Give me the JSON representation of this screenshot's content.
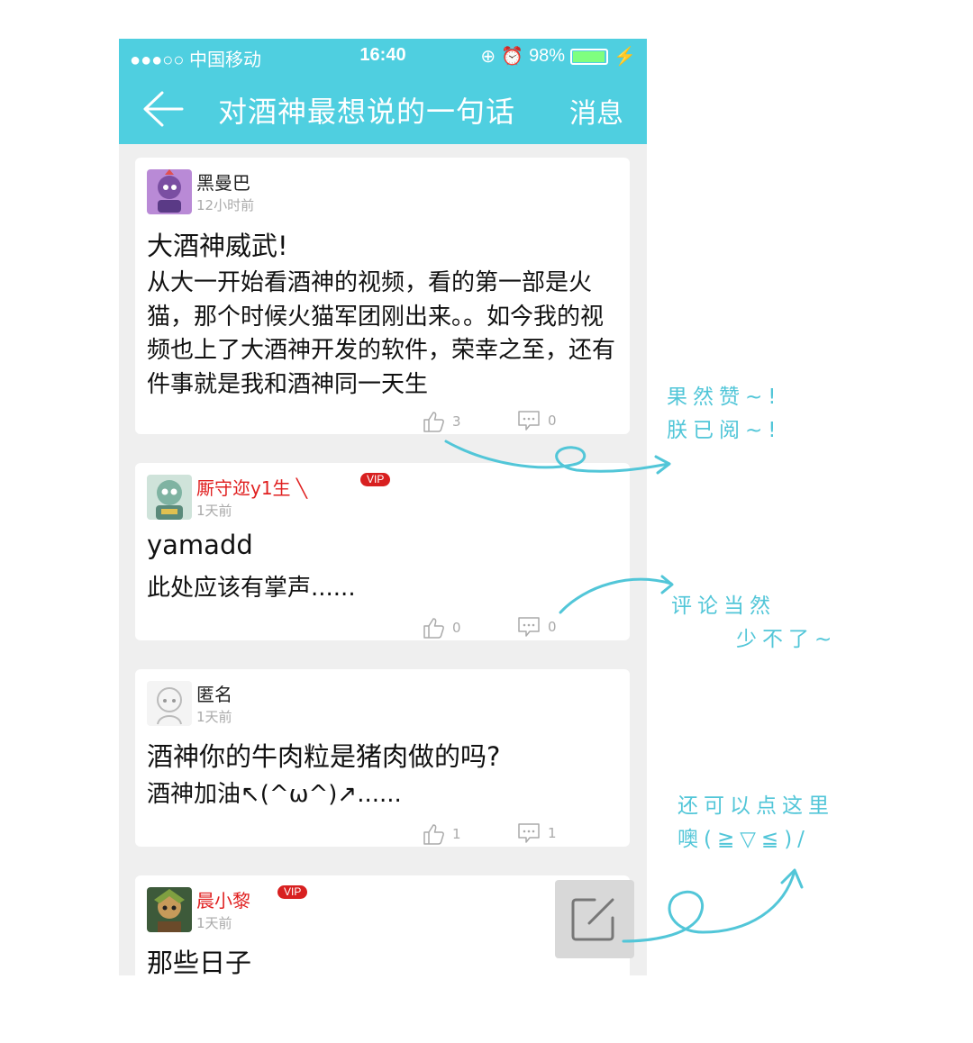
{
  "status": {
    "signal": "●●●○○ 中国移动",
    "time": "16:40",
    "battery": "98%"
  },
  "nav": {
    "title": "对酒神最想说的一句话",
    "right": "消息"
  },
  "posts": [
    {
      "user": "黑曼巴",
      "time": "12小时前",
      "title": "大酒神威武!",
      "body": "从大一开始看酒神的视频，看的第一部是火猫，那个时候火猫军团刚出来。。如今我的视频也上了大酒神开发的软件，荣幸之至，还有件事就是我和酒神同一天生",
      "likes": "3",
      "comments": "0"
    },
    {
      "user": "厮守迩y1生 ╲",
      "vip": "VIP",
      "time": "1天前",
      "title": "yamadd",
      "body": "此处应该有掌声......",
      "likes": "0",
      "comments": "0"
    },
    {
      "user": "匿名",
      "time": "1天前",
      "title": "酒神你的牛肉粒是猪肉做的吗?",
      "body": "酒神加油↖(^ω^)↗......",
      "likes": "1",
      "comments": "1"
    },
    {
      "user": "晨小黎",
      "vip": "VIP",
      "time": "1天前",
      "title": "那些日子"
    }
  ],
  "annotations": {
    "a1": "果然赞~!",
    "a2": "朕已阅~!",
    "b1": "评论当然",
    "b2": "少不了~",
    "c1": "还可以点这里",
    "c2": "噢(≧▽≦)/"
  },
  "icons": {
    "back": "back-arrow-icon",
    "like": "thumbs-up-icon",
    "comment": "comment-icon",
    "compose": "compose-icon"
  },
  "colors": {
    "accent": "#4fcfe0",
    "annotation": "#52c6d8",
    "vip": "#d82020"
  }
}
